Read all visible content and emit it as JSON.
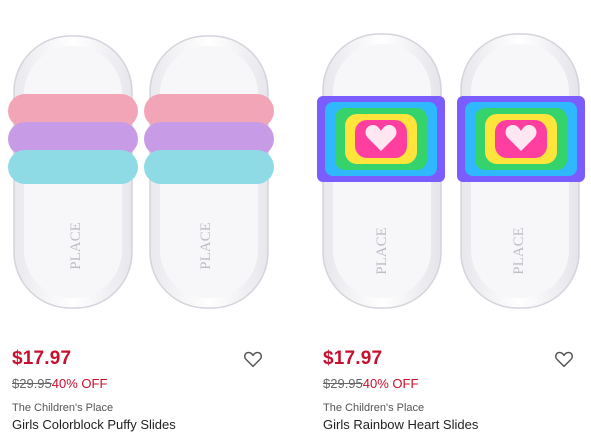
{
  "products": [
    {
      "price": "$17.97",
      "original_price": "$29.95",
      "discount": "40% OFF",
      "brand": "The Children's Place",
      "name": "Girls Colorblock Puffy Slides",
      "sole_stamp": "PLACE",
      "strap_colors": [
        "#f3a5b8",
        "#c89be6",
        "#8edbe6"
      ],
      "wishlist_icon": "heart-outline-icon"
    },
    {
      "price": "$17.97",
      "original_price": "$29.95",
      "discount": "40% OFF",
      "brand": "The Children's Place",
      "name": "Girls Rainbow Heart Slides",
      "sole_stamp": "PLACE",
      "strap_colors": [
        "#ff3fa0",
        "#ffe53b",
        "#35d36b",
        "#2fb7ff",
        "#7b5cff"
      ],
      "wishlist_icon": "heart-outline-icon"
    }
  ],
  "colors": {
    "sale_red": "#c8102e",
    "strike_gray": "#666666"
  }
}
